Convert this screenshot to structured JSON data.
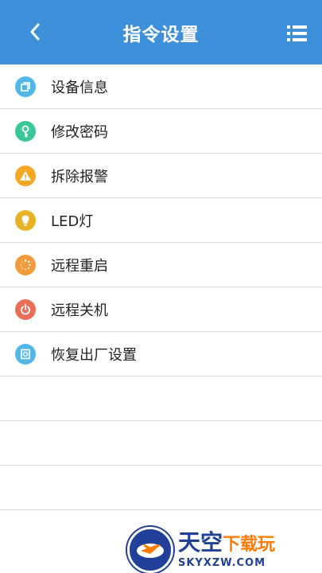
{
  "header": {
    "title": "指令设置",
    "back_icon": "chevron-left-icon",
    "menu_icon": "list-menu-icon"
  },
  "colors": {
    "header_bg": "#3f90da",
    "divider": "#d9d9d9"
  },
  "items": [
    {
      "label": "设备信息",
      "icon": "device-info-icon",
      "color": "#52b6e6"
    },
    {
      "label": "修改密码",
      "icon": "key-icon",
      "color": "#3cc796"
    },
    {
      "label": "拆除报警",
      "icon": "warning-icon",
      "color": "#f5a623"
    },
    {
      "label": "LED灯",
      "icon": "bulb-icon",
      "color": "#e6b325"
    },
    {
      "label": "远程重启",
      "icon": "restart-icon",
      "color": "#f29b3e"
    },
    {
      "label": "远程关机",
      "icon": "power-icon",
      "color": "#e8705a"
    },
    {
      "label": "恢复出厂设置",
      "icon": "factory-reset-icon",
      "color": "#52b6e6"
    }
  ],
  "watermark": {
    "title": "天空",
    "title_suffix": "下载玩",
    "url": "SKYXZW.COM"
  }
}
